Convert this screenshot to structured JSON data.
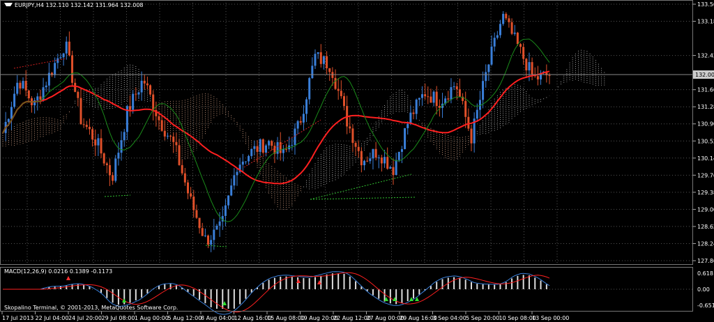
{
  "window": {
    "symbol_line": "EURJPY,H4  132.110 132.142 131.964 132.008",
    "current_price": "132.008"
  },
  "price_axis": {
    "ticks": [
      "133.560",
      "133.180",
      "132.420",
      "131.660",
      "131.280",
      "130.900",
      "130.520",
      "130.140",
      "129.760",
      "129.380",
      "129.000",
      "128.620",
      "128.240",
      "127.860"
    ]
  },
  "time_axis": {
    "labels": [
      "17 Jul 2013",
      "22 Jul 04:00",
      "24 Jul 20:00",
      "29 Jul 08:00",
      "1 Aug 00:00",
      "5 Aug 12:00",
      "8 Aug 04:00",
      "12 Aug 16:00",
      "15 Aug 08:00",
      "19 Aug 20:00",
      "22 Aug 12:00",
      "27 Aug 00:00",
      "29 Aug 16:00",
      "3 Sep 04:00",
      "5 Sep 20:00",
      "10 Sep 08:00",
      "13 Sep 00:00"
    ]
  },
  "macd": {
    "title": "MACD(12,26,9) 0.0216 0.1389 -0.1173",
    "ticks": [
      "0.618",
      "0.00",
      "-0.6517"
    ]
  },
  "footer": {
    "copyright": "Skopalino Terminal, © 2001-2013, MetaQuotes Software Corp."
  },
  "colors": {
    "bull": "#3a7fd9",
    "bear": "#e0502a",
    "ma_fast": "#1a8a1a",
    "ma_slow": "#ff2020",
    "cloud": "#e8b090",
    "cloud_alt": "#cfcfcf",
    "grid": "#555555",
    "signal": "#ff2020",
    "macd_line": "#3a7fd9"
  },
  "chart_data": {
    "type": "candlestick",
    "symbol": "EURJPY",
    "timeframe": "H4",
    "ylim": [
      127.86,
      133.56
    ],
    "grid": true,
    "approx_close_path": [
      130.7,
      131.9,
      131.3,
      132.0,
      132.7,
      131.0,
      130.5,
      129.7,
      131.2,
      131.9,
      131.0,
      130.4,
      129.2,
      128.3,
      128.6,
      130.0,
      130.3,
      130.5,
      130.2,
      130.9,
      132.4,
      132.2,
      131.0,
      130.1,
      130.3,
      129.9,
      131.0,
      131.6,
      131.4,
      131.8,
      130.6,
      132.1,
      133.3,
      132.6,
      131.9,
      132.0
    ]
  }
}
